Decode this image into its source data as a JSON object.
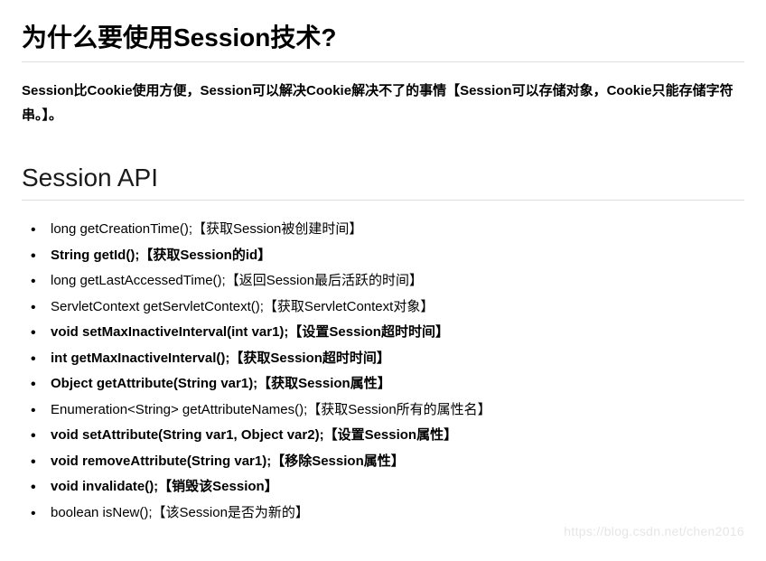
{
  "heading1": "为什么要使用Session技术?",
  "intro_paragraph": "Session比Cookie使用方便，Session可以解决Cookie解决不了的事情【Session可以存储对象，Cookie只能存储字符串。】。",
  "heading2": "Session API",
  "api_items": [
    {
      "text": "long getCreationTime();【获取Session被创建时间】",
      "bold": false
    },
    {
      "text": "String getId();【获取Session的id】",
      "bold": true
    },
    {
      "text": "long getLastAccessedTime();【返回Session最后活跃的时间】",
      "bold": false
    },
    {
      "text": "ServletContext getServletContext();【获取ServletContext对象】",
      "bold": false
    },
    {
      "text": "void setMaxInactiveInterval(int var1);【设置Session超时时间】",
      "bold": true
    },
    {
      "text": "int getMaxInactiveInterval();【获取Session超时时间】",
      "bold": true
    },
    {
      "text": "Object getAttribute(String var1);【获取Session属性】",
      "bold": true
    },
    {
      "text": "Enumeration<String> getAttributeNames();【获取Session所有的属性名】",
      "bold": false
    },
    {
      "text": "void setAttribute(String var1, Object var2);【设置Session属性】",
      "bold": true
    },
    {
      "text": "void removeAttribute(String var1);【移除Session属性】",
      "bold": true
    },
    {
      "text": "void invalidate();【销毁该Session】",
      "bold": true
    },
    {
      "text": "boolean isNew();【该Session是否为新的】",
      "bold": false
    }
  ],
  "watermark": "https://blog.csdn.net/chen2016"
}
